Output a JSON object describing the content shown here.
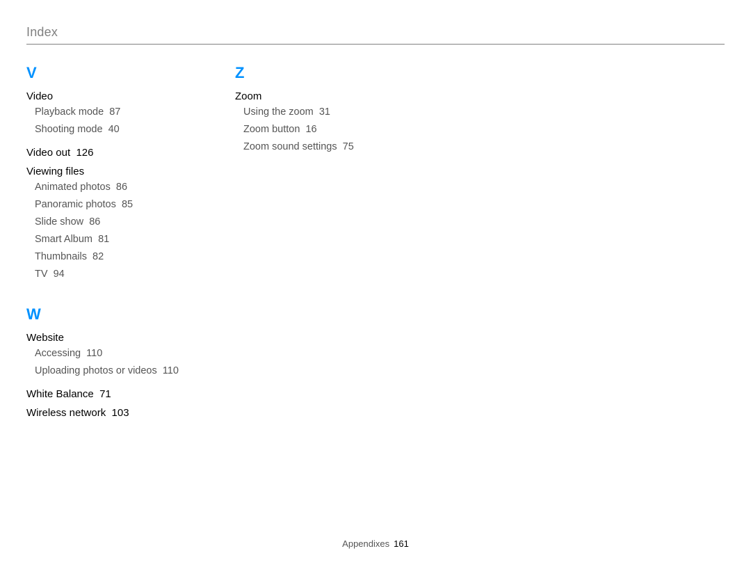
{
  "page_header": "Index",
  "footer": {
    "section": "Appendixes",
    "page": "161"
  },
  "col1": {
    "sectionV": {
      "letter": "V",
      "video": {
        "title": "Video",
        "playback": {
          "label": "Playback mode",
          "page": "87"
        },
        "shooting": {
          "label": "Shooting mode",
          "page": "40"
        }
      },
      "video_out": {
        "label": "Video out",
        "page": "126"
      },
      "viewing_files": {
        "title": "Viewing files",
        "animated": {
          "label": "Animated photos",
          "page": "86"
        },
        "panoramic": {
          "label": "Panoramic photos",
          "page": "85"
        },
        "slide": {
          "label": "Slide show",
          "page": "86"
        },
        "smart": {
          "label": "Smart Album",
          "page": "81"
        },
        "thumb": {
          "label": "Thumbnails",
          "page": "82"
        },
        "tv": {
          "label": "TV",
          "page": "94"
        }
      }
    },
    "sectionW": {
      "letter": "W",
      "website": {
        "title": "Website",
        "accessing": {
          "label": "Accessing",
          "page": "110"
        },
        "uploading": {
          "label": "Uploading photos or videos",
          "page": "110"
        }
      },
      "white_balance": {
        "label": "White Balance",
        "page": "71"
      },
      "wireless": {
        "label": "Wireless network",
        "page": "103"
      }
    }
  },
  "col2": {
    "sectionZ": {
      "letter": "Z",
      "zoom": {
        "title": "Zoom",
        "using": {
          "label": "Using the zoom",
          "page": "31"
        },
        "button": {
          "label": "Zoom button",
          "page": "16"
        },
        "sound": {
          "label": "Zoom sound settings",
          "page": "75"
        }
      }
    }
  }
}
